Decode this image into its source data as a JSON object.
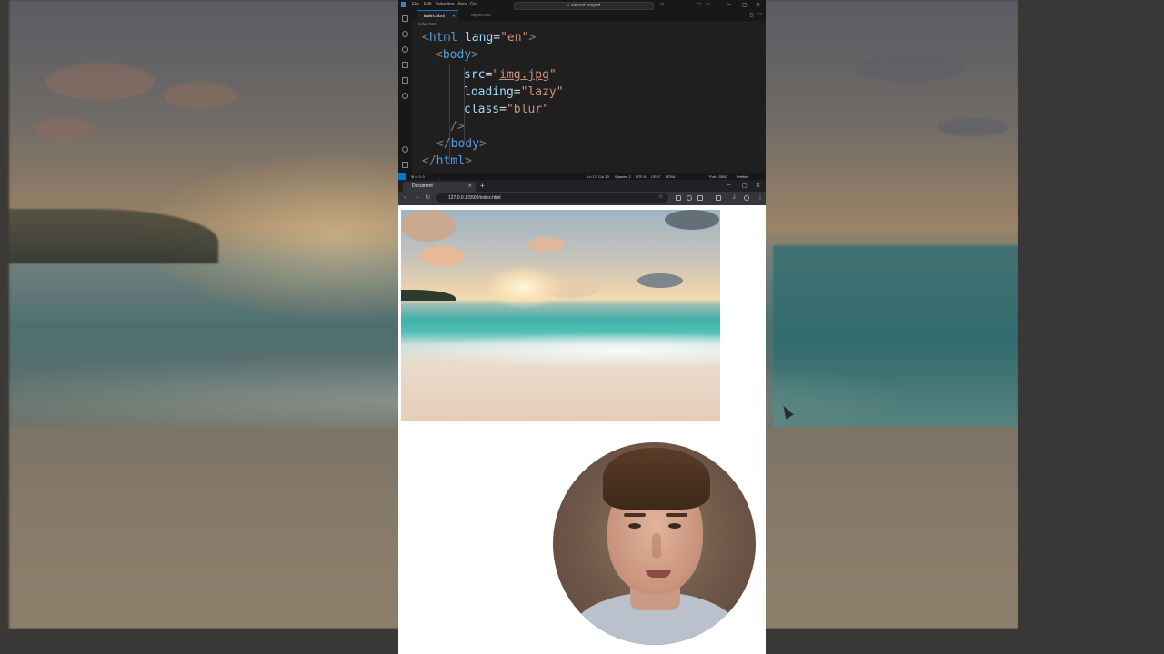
{
  "vscode": {
    "menu": [
      "File",
      "Edit",
      "Selection",
      "View",
      "Go"
    ],
    "search_placeholder": "current-project",
    "tabs": [
      {
        "label": "index.html",
        "active": true
      },
      {
        "label": "styles.css",
        "active": false
      }
    ],
    "breadcrumb": "index.html",
    "code": {
      "l1_open": "<",
      "l1_tag": "html",
      "l1_attr": " lang",
      "l1_eq": "=",
      "l1_val": "\"en\"",
      "l1_close": ">",
      "l2_open": "<",
      "l2_tag": "body",
      "l2_close": ">",
      "l3_attr": "src",
      "l3_eq": "=",
      "l3_q1": "\"",
      "l3_val": "img.jpg",
      "l3_q2": "\"",
      "l4_attr": "loading",
      "l4_eq": "=",
      "l4_val": "\"lazy\"",
      "l5_attr": "class",
      "l5_eq": "=",
      "l5_val": "\"blur\"",
      "l6": "/>",
      "l7_open": "</",
      "l7_tag": "body",
      "l7_close": ">",
      "l8_open": "</",
      "l8_tag": "html",
      "l8_close": ">"
    },
    "status": {
      "problems": "⊗ 0 ⚠ 0",
      "position": "Ln 17, Col 10",
      "spaces": "Spaces: 2",
      "encoding": "UTF-8",
      "eol": "CRLF",
      "language": "HTML",
      "port": "Port : 5500",
      "prettier": "Prettier"
    }
  },
  "browser": {
    "tab_title": "Document",
    "url": "127.0.0.1:5500/index.html"
  },
  "colors": {
    "editor_bg": "#1f1f1f",
    "accent": "#0078d4",
    "tag": "#569cd6",
    "attr": "#9cdcfe",
    "string": "#ce9178"
  }
}
